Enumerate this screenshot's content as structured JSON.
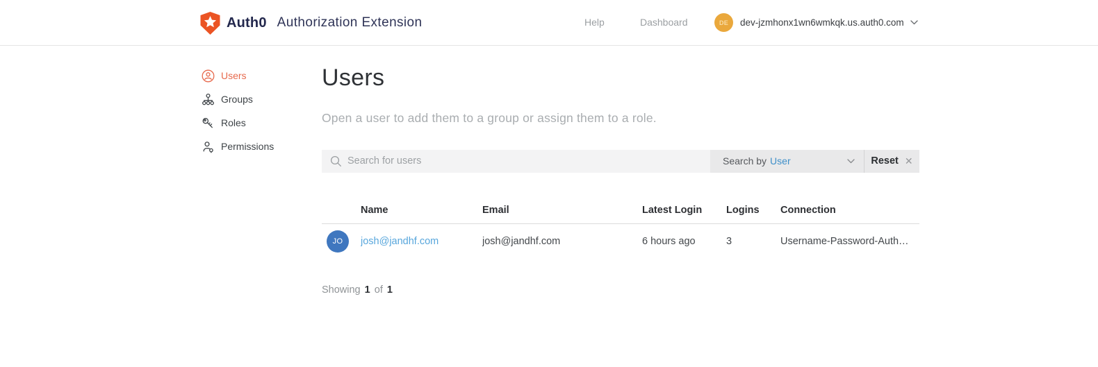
{
  "app": {
    "brand": "Auth0",
    "title": "Authorization Extension",
    "nav": {
      "help": "Help",
      "dashboard": "Dashboard"
    },
    "tenant": {
      "initials": "DE",
      "domain": "dev-jzmhonx1wn6wmkqk.us.auth0.com"
    }
  },
  "sidebar": {
    "items": [
      {
        "label": "Users",
        "icon": "user-circle-icon",
        "active": true
      },
      {
        "label": "Groups",
        "icon": "org-chart-icon",
        "active": false
      },
      {
        "label": "Roles",
        "icon": "key-icon",
        "active": false
      },
      {
        "label": "Permissions",
        "icon": "person-check-icon",
        "active": false
      }
    ]
  },
  "main": {
    "title": "Users",
    "subtitle": "Open a user to add them to a group or assign them to a role.",
    "search": {
      "placeholder": "Search for users",
      "search_by_label": "Search by",
      "search_by_value": "User",
      "reset_label": "Reset",
      "close_glyph": "✕"
    },
    "table": {
      "headers": [
        "Name",
        "Email",
        "Latest Login",
        "Logins",
        "Connection"
      ],
      "rows": [
        {
          "initials": "JO",
          "name": "josh@jandhf.com",
          "email": "josh@jandhf.com",
          "latest_login": "6 hours ago",
          "logins": "3",
          "connection": "Username-Password-Auth…"
        }
      ]
    },
    "footer": {
      "showing_label": "Showing",
      "count": "1",
      "of_label": "of",
      "total": "1"
    }
  },
  "colors": {
    "brand_orange": "#EB5424",
    "active_sidebar": "#E7694C",
    "link_blue": "#57A6DC",
    "dropdown_value_blue": "#3E8FC9",
    "row_avatar_blue": "#3F77BF",
    "tenant_avatar_amber": "#EAA83C"
  }
}
